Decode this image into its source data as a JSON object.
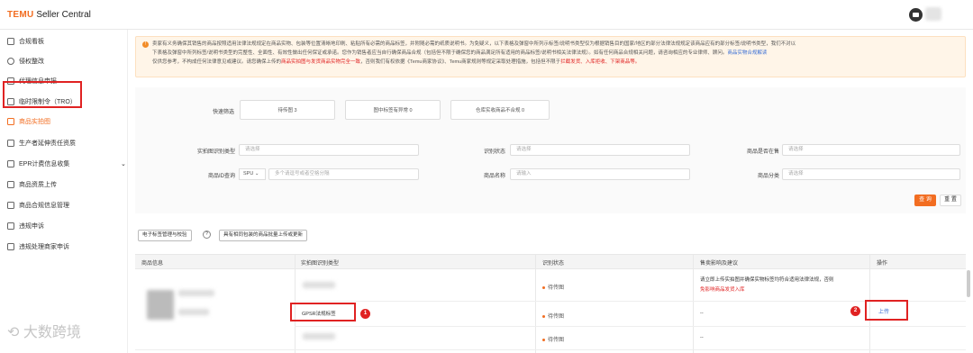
{
  "header": {
    "brand": "TEMU",
    "app_title": "Seller Central"
  },
  "sidebar": {
    "items": [
      {
        "label": "合规看板"
      },
      {
        "label": "侵权整改"
      },
      {
        "label": "代理信息申报"
      },
      {
        "label": "临时限制令（TRO）"
      },
      {
        "label": "商品实拍图"
      },
      {
        "label": "生产者延伸责任资质"
      },
      {
        "label": "EPR计费信息收集"
      },
      {
        "label": "商品资质上传"
      },
      {
        "label": "商品合规信息管理"
      },
      {
        "label": "违规申诉"
      },
      {
        "label": "违规处理商家申诉"
      }
    ],
    "active_index": 4
  },
  "notice": {
    "line1": "卖家有义务确保其销售的商品按照适用法律法规规定在商品实物、包装等位置清晰地印刷、粘贴所有必需的商品标签，并附随必需的纸质说明书。为免疑义，以下表格及弹窗中所列示标签/说明书类型仅为根据销售目的国家/地区的部分法律法规规定该商品应有的部分标签/说明书类型，我们不对以",
    "line2": "下表格及弹窗中所列标签/说明书类型的完整性、全面性、有效性做出任何保证或承诺。您作为销售者应当自行确保商品合规（包括但不限于确保您的商品满足所有适用的商品标签/说明书相关法律法规）。如有任何商品合规相关问题，请咨询相应的专业律师、顾问。",
    "line2_link": "商品实物合规解读",
    "line3_a": "仅供您参考，不构成任何法律意见或建议。请您确保上传的",
    "line3_hl": "商品实拍图与发货商品实物完全一致",
    "line3_b": "，否则我们有权依据《Temu商家协议》、Temu商家规则等规定采取处理措施，包括但不限于",
    "line3_hl2": "拦截发货、入库拒收、下架商品等。"
  },
  "quick_filter": {
    "label": "快速筛选",
    "buttons": [
      "待传图 3",
      "图中标签有异常 0",
      "仓库实收商品不合规 0"
    ]
  },
  "filters": {
    "recognition_type": {
      "label": "实拍图识别类型",
      "placeholder": "请选择"
    },
    "recognition_status": {
      "label": "识别状态",
      "placeholder": "请选择"
    },
    "on_sale": {
      "label": "商品是否在售",
      "placeholder": "请选择"
    },
    "product_id": {
      "label": "商品ID查询",
      "select": "SPU",
      "placeholder": "多个请逗号或者空格分隔"
    },
    "product_name": {
      "label": "商品名称",
      "placeholder": "请输入"
    },
    "category": {
      "label": "商品分类",
      "placeholder": "请选择"
    },
    "query_label": "查 询",
    "reset_label": "重 置"
  },
  "toolbar": {
    "label_manage": "电子标签管理与校验",
    "help_icon": "?",
    "batch_upload": "具有相同包装的商品批量上传或更新"
  },
  "table": {
    "columns": [
      "商品信息",
      "实拍图识别类型",
      "识别状态",
      "售卖影响及建议",
      "操作"
    ],
    "rows": [
      {
        "type": "",
        "status": "待传图",
        "advice_a": "请立即上传实拍图并确保实物标签均符合适用法律法规，否则",
        "advice_b": "免影响商品发货入库",
        "action": ""
      },
      {
        "type": "GPSR法规标签",
        "status": "待传图",
        "advice": "--",
        "action": "上传"
      },
      {
        "type": "",
        "status": "待传图",
        "advice": "--",
        "action": ""
      }
    ]
  },
  "callouts": [
    "1",
    "2"
  ],
  "watermark": "大数跨境",
  "colors": {
    "brand": "#f26d21",
    "annotation": "#e02222",
    "link": "#3b6fd4"
  }
}
